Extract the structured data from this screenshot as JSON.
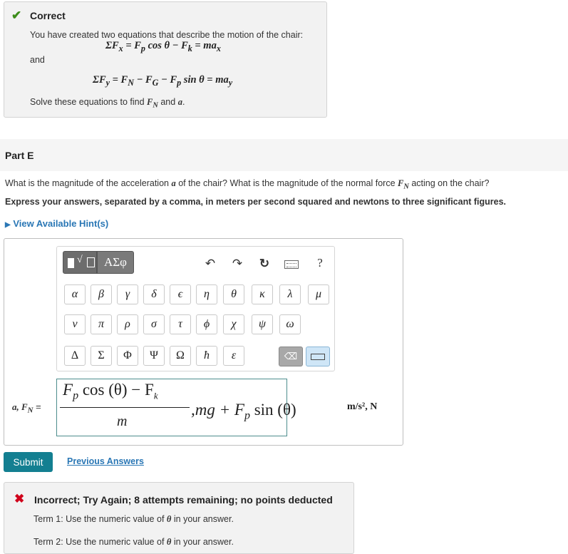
{
  "feedback_correct": {
    "icon": "check-icon",
    "title": "Correct",
    "text": "You have created two equations that describe the motion of the chair:",
    "eq1": {
      "lhs": "ΣF",
      "lhs_sub": "x",
      "mid1": " = F",
      "mid1_sub": "p",
      "mid2": " cos θ − F",
      "mid2_sub": "k",
      "rhs": " = ma",
      "rhs_sub": "x"
    },
    "and_word": "and",
    "eq2": {
      "lhs": "ΣF",
      "lhs_sub": "y",
      "mid1": " = F",
      "mid1_sub": "N",
      "mid2": " − F",
      "mid2_sub": "G",
      "mid3": " − F",
      "mid3_sub": "p",
      "rhs": " sin θ = ma",
      "rhs_sub": "y"
    },
    "solve_prefix": "Solve these equations to find ",
    "solve_var1": "F",
    "solve_var1_sub": "N",
    "solve_mid": " and ",
    "solve_var2": "a",
    "solve_end": "."
  },
  "part": {
    "label": "Part E",
    "question_prefix": "What is the magnitude of the acceleration ",
    "question_var1": "a",
    "question_mid": " of the chair? What is the magnitude of the normal force ",
    "question_var2": "F",
    "question_var2_sub": "N",
    "question_end": " acting on the chair?",
    "instruction": "Express your answers, separated by a comma, in meters per second squared and newtons to three significant figures.",
    "hints_link": "View Available Hint(s)"
  },
  "toolbar": {
    "tab_greek": "ΑΣφ",
    "undo": "↶",
    "redo": "↷",
    "reset": "↻",
    "help": "?",
    "greek_row1": [
      "α",
      "β",
      "γ",
      "δ",
      "ϵ",
      "η",
      "θ",
      "κ",
      "λ",
      "μ"
    ],
    "greek_row2": [
      "ν",
      "π",
      "ρ",
      "σ",
      "τ",
      "ϕ",
      "χ",
      "ψ",
      "ω"
    ],
    "greek_row3": [
      "Δ",
      "Σ",
      "Φ",
      "Ψ",
      "Ω",
      "ħ",
      "ε"
    ],
    "backspace": "⌫"
  },
  "answer": {
    "label_var1": "a",
    "label_sep": ", ",
    "label_var2": "F",
    "label_var2_sub": "N",
    "label_eq": " =",
    "numerator": "F",
    "numerator_sub": "p",
    "numerator_rest": " cos (θ) − F",
    "numerator_sub2": "k",
    "denominator": "m",
    "after_frac": ",mg + F",
    "after_sub": "p",
    "after_rest": " sin (θ)",
    "units": "m/s², N"
  },
  "actions": {
    "submit": "Submit",
    "previous_answers": "Previous Answers"
  },
  "feedback_incorrect": {
    "icon": "x-icon",
    "title": "Incorrect; Try Again; 8 attempts remaining; no points deducted",
    "term1_prefix": "Term 1: Use the numeric value of ",
    "term1_var": "θ",
    "term1_end": " in your answer.",
    "term2_prefix": "Term 2: Use the numeric value of ",
    "term2_var": "θ",
    "term2_end": " in your answer."
  }
}
